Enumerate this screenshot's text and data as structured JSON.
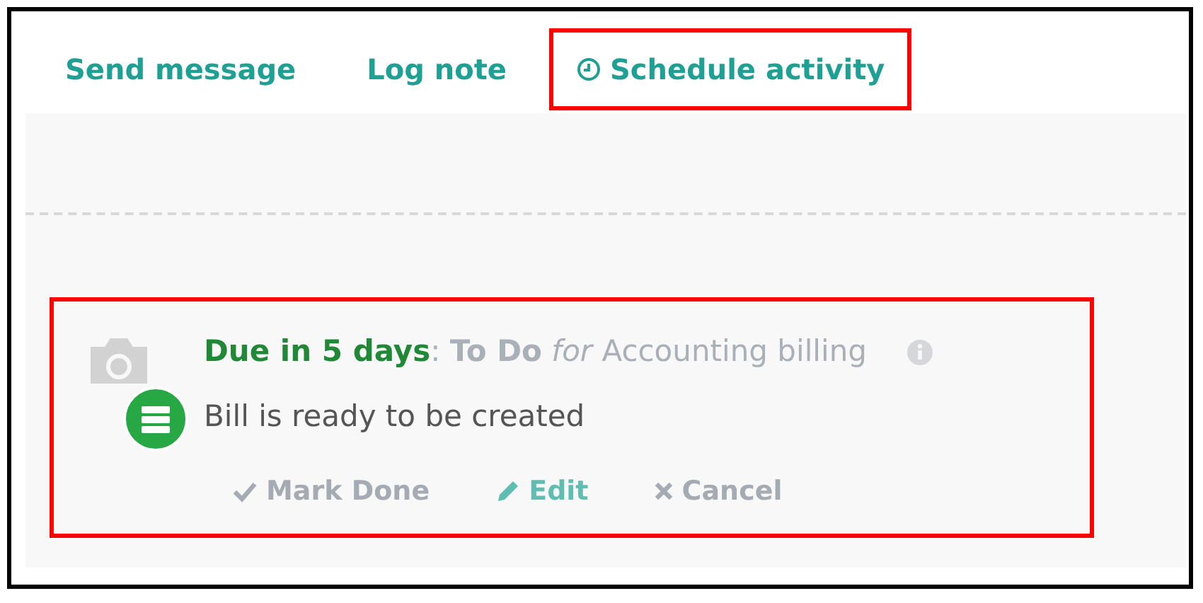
{
  "tabs": [
    {
      "label": "Send message",
      "kind": "plain",
      "highlighted": false
    },
    {
      "label": "Log note",
      "kind": "plain",
      "highlighted": false
    },
    {
      "label": "Schedule activity",
      "kind": "clock",
      "highlighted": true
    }
  ],
  "activity": {
    "highlighted": true,
    "due": "Due in 5 days",
    "summary": ": **To Do** *for* Accounting billing",
    "note": "Bill is ready to be created",
    "actions": [
      {
        "label": "Mark Done",
        "kind": "check",
        "disabled": true
      },
      {
        "label": "Edit",
        "kind": "pencil",
        "disabled": false
      },
      {
        "label": "Cancel",
        "kind": "cross",
        "disabled": true
      }
    ]
  }
}
